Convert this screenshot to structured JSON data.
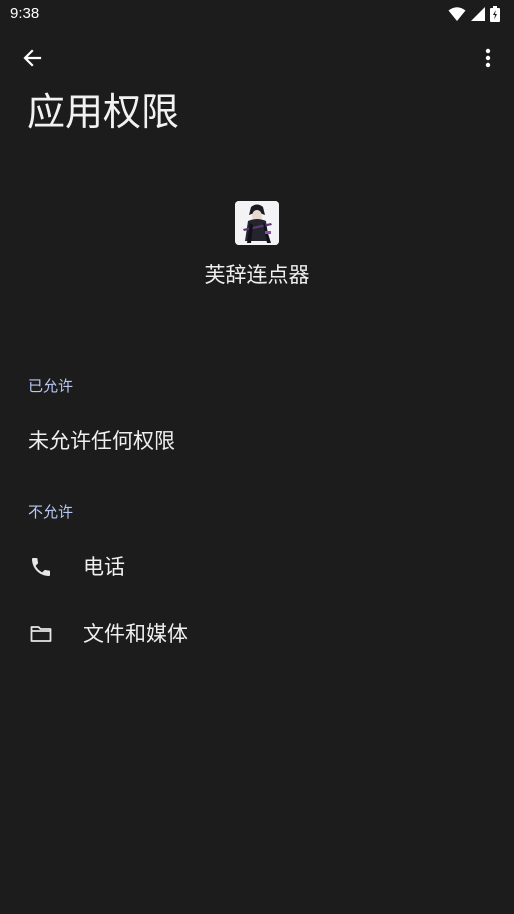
{
  "status_bar": {
    "time": "9:38",
    "icons": [
      "wifi-icon",
      "signal-icon",
      "battery-icon"
    ]
  },
  "toolbar": {
    "back_icon": "arrow-back-icon",
    "more_icon": "more-vert-icon"
  },
  "page": {
    "title": "应用权限"
  },
  "app": {
    "name": "芙辞连点器",
    "icon": "app-icon-anime-character"
  },
  "sections": {
    "allowed": {
      "header": "已允许",
      "empty_text": "未允许任何权限"
    },
    "denied": {
      "header": "不允许",
      "items": [
        {
          "label": "电话",
          "icon": "phone-icon"
        },
        {
          "label": "文件和媒体",
          "icon": "folder-icon"
        }
      ]
    }
  },
  "colors": {
    "background": "#1c1c1c",
    "section_header": "#b9c6f2",
    "text": "#efefef"
  }
}
